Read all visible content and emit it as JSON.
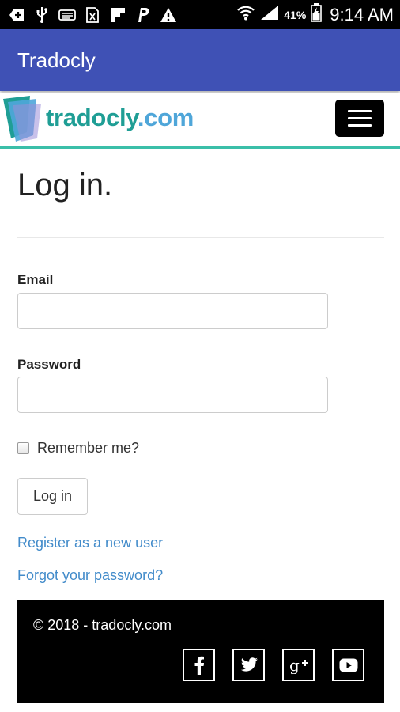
{
  "status_bar": {
    "icons": [
      "add-box-icon",
      "usb-icon",
      "voicemail-icon",
      "no-sim-icon",
      "flipboard-icon",
      "paypal-icon",
      "warning-icon",
      "wifi-icon",
      "signal-icon",
      "battery-icon"
    ],
    "battery_percent": "41%",
    "time": "9:14 AM"
  },
  "app_bar": {
    "title": "Tradocly"
  },
  "site_header": {
    "logo_text_part1": "tradocly",
    "logo_text_part2": ".com",
    "menu_icon": "hamburger-menu-icon"
  },
  "login": {
    "title": "Log in.",
    "email_label": "Email",
    "email_value": "",
    "password_label": "Password",
    "password_value": "",
    "remember_label": "Remember me?",
    "remember_checked": false,
    "submit_label": "Log in",
    "register_link": "Register as a new user",
    "forgot_link": "Forgot your password?"
  },
  "footer": {
    "copyright": "© 2018 - tradocly.com",
    "social": [
      "facebook-icon",
      "twitter-icon",
      "google-plus-icon",
      "youtube-icon"
    ]
  },
  "colors": {
    "app_bar": "#3f51b5",
    "logo_teal": "#1f9e95",
    "logo_blue": "#4fa6d9",
    "header_border": "#3bbfa9",
    "link": "#428bca",
    "footer_bg": "#000000"
  }
}
